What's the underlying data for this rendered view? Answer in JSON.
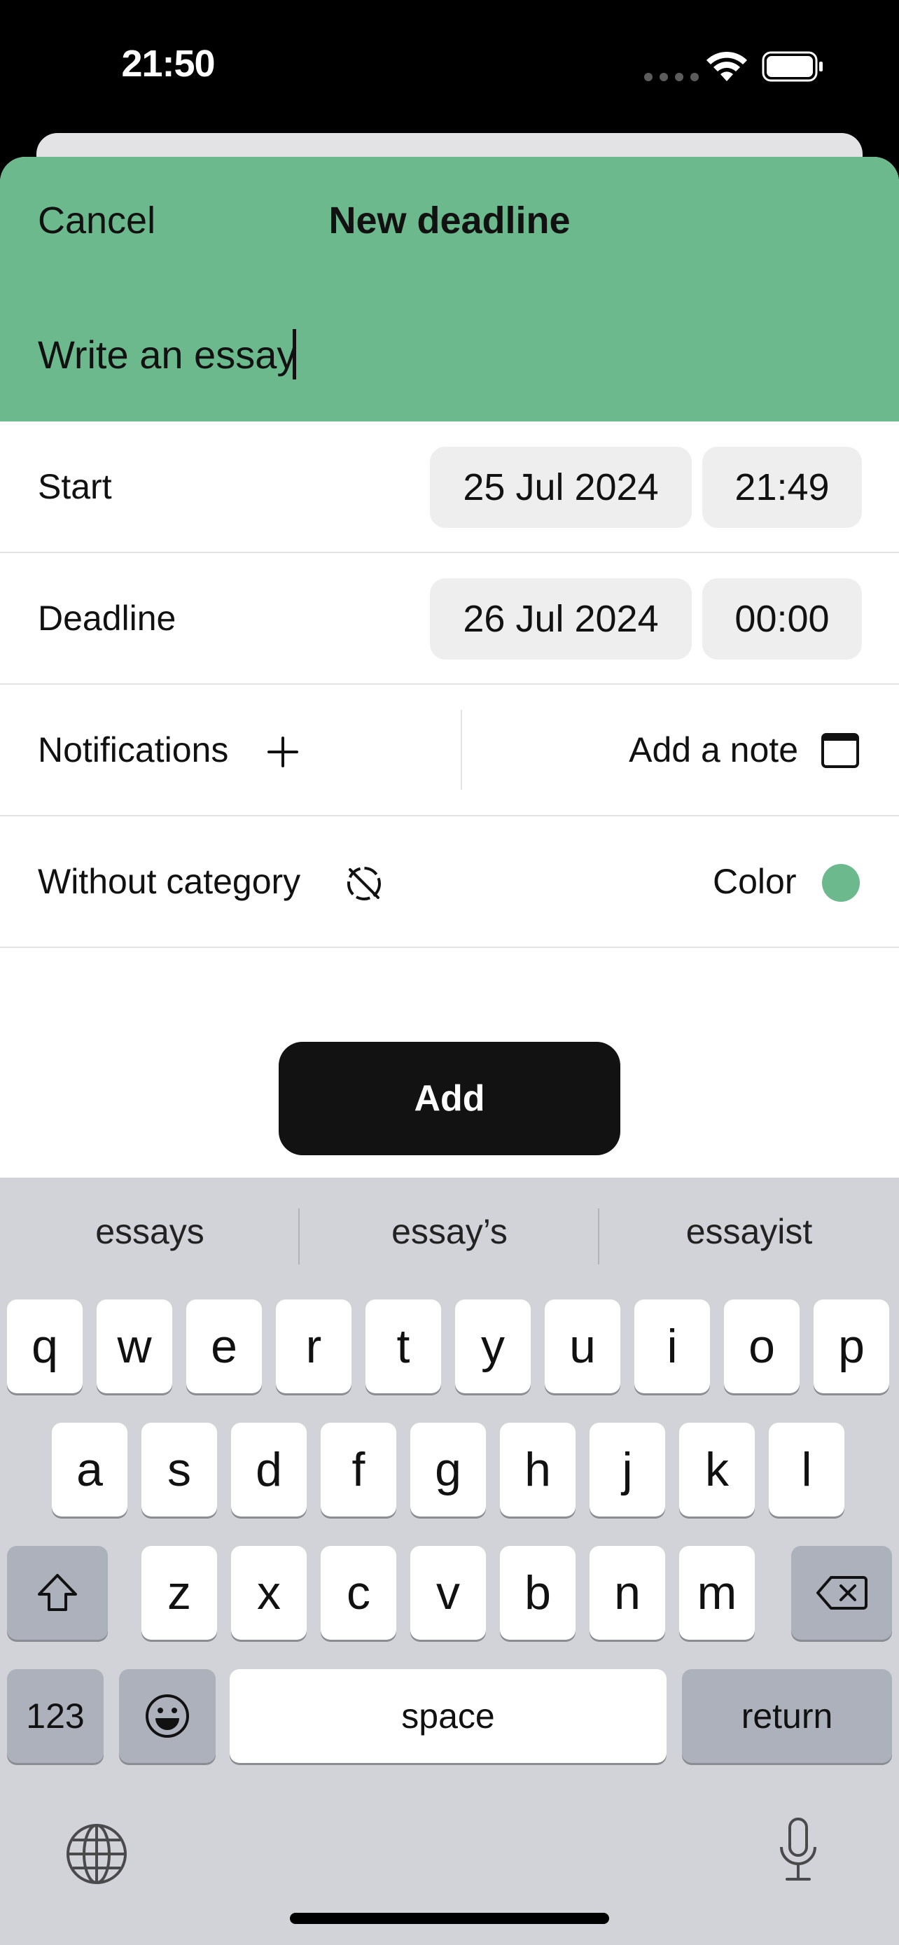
{
  "status": {
    "time": "21:50"
  },
  "header": {
    "cancel_label": "Cancel",
    "title": "New deadline",
    "task_text": "Write an essay",
    "accent_color": "#6bb98d"
  },
  "start": {
    "label": "Start",
    "date": "25 Jul 2024",
    "time": "21:49"
  },
  "deadline": {
    "label": "Deadline",
    "date": "26 Jul 2024",
    "time": "00:00"
  },
  "notifications": {
    "label": "Notifications",
    "add_icon": "plus-icon"
  },
  "note": {
    "label": "Add a note",
    "icon": "note-icon"
  },
  "category": {
    "label": "Without category",
    "icon": "no-category-icon"
  },
  "color": {
    "label": "Color",
    "value": "#6bb98d"
  },
  "add_button": {
    "label": "Add"
  },
  "keyboard": {
    "suggestions": [
      "essays",
      "essay’s",
      "essayist"
    ],
    "row1": [
      "q",
      "w",
      "e",
      "r",
      "t",
      "y",
      "u",
      "i",
      "o",
      "p"
    ],
    "row2": [
      "a",
      "s",
      "d",
      "f",
      "g",
      "h",
      "j",
      "k",
      "l"
    ],
    "row3": [
      "z",
      "x",
      "c",
      "v",
      "b",
      "n",
      "m"
    ],
    "numbers_label": "123",
    "space_label": "space",
    "return_label": "return"
  }
}
